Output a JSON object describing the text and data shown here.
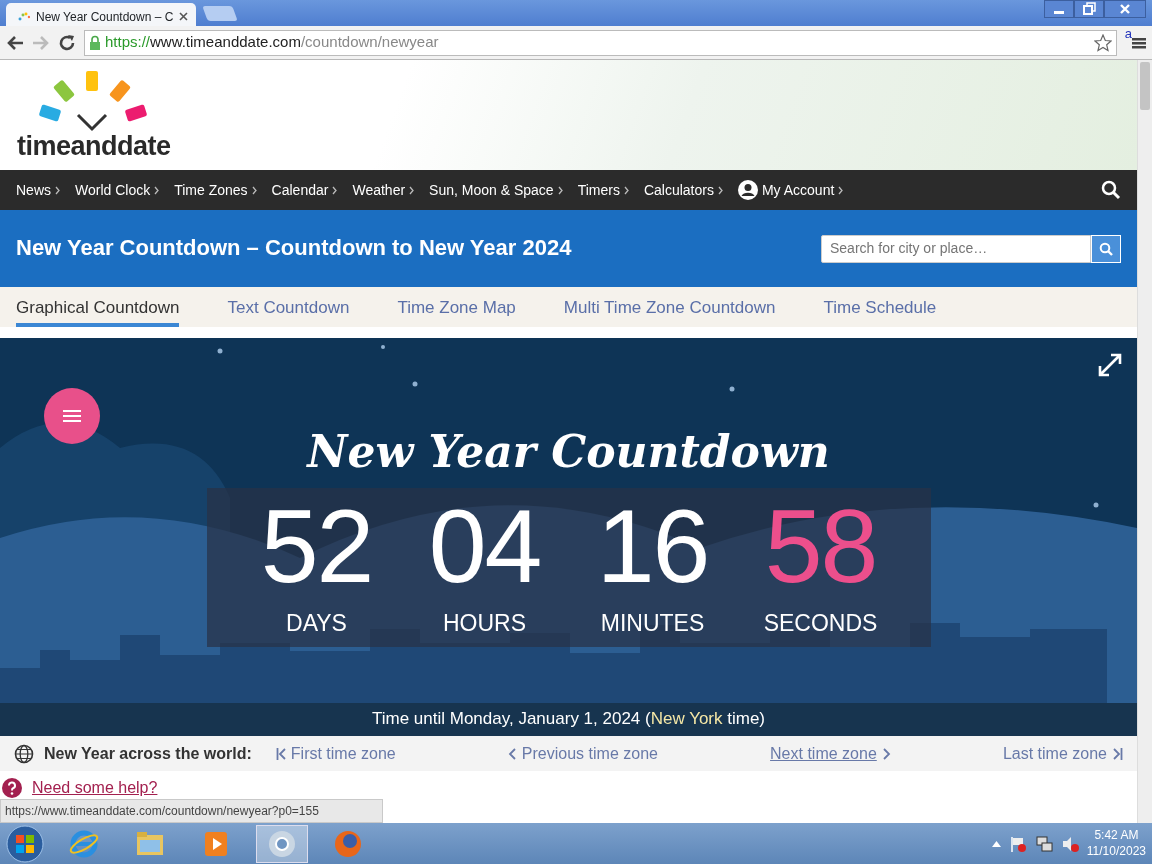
{
  "browser": {
    "tab_title": "New Year Countdown – C",
    "url": {
      "scheme": "https://",
      "host": "www.timeanddate.com",
      "path": "/countdown/newyear"
    },
    "extension_badge": "a"
  },
  "site": {
    "logo_text": "timeanddate",
    "nav": [
      {
        "label": "News"
      },
      {
        "label": "World Clock"
      },
      {
        "label": "Time Zones"
      },
      {
        "label": "Calendar"
      },
      {
        "label": "Weather"
      },
      {
        "label": "Sun, Moon & Space"
      },
      {
        "label": "Timers"
      },
      {
        "label": "Calculators"
      },
      {
        "label": "My Account",
        "kind": "account"
      }
    ],
    "page_title": "New Year Countdown – Countdown to New Year 2024",
    "search": {
      "placeholder": "Search for city or place…"
    },
    "subtabs": [
      {
        "label": "Graphical Countdown",
        "selected": true
      },
      {
        "label": "Text Countdown",
        "selected": false
      },
      {
        "label": "Time Zone Map",
        "selected": false
      },
      {
        "label": "Multi Time Zone Countdown",
        "selected": false
      },
      {
        "label": "Time Schedule",
        "selected": false
      }
    ],
    "countdown": {
      "title": "New Year Countdown",
      "units": [
        {
          "value": "52",
          "label": "DAYS",
          "highlight": false
        },
        {
          "value": "04",
          "label": "HOURS",
          "highlight": false
        },
        {
          "value": "16",
          "label": "MINUTES",
          "highlight": false
        },
        {
          "value": "58",
          "label": "SECONDS",
          "highlight": true
        }
      ],
      "caption": {
        "before": "Time until Monday, January 1, 2024 (",
        "place": "New York",
        "after": " time)"
      }
    },
    "world_nav": {
      "label": "New Year across the world:",
      "links": [
        {
          "label": "First time zone",
          "kind": "first",
          "hovered": false
        },
        {
          "label": "Previous time zone",
          "kind": "prev",
          "hovered": false
        },
        {
          "label": "Next time zone",
          "kind": "next",
          "hovered": true
        },
        {
          "label": "Last time zone",
          "kind": "last",
          "hovered": false
        }
      ]
    },
    "help": "Need some help?",
    "status_url": "https://www.timeanddate.com/countdown/newyear?p0=155"
  },
  "taskbar": {
    "time": "5:42 AM",
    "date": "11/10/2023"
  }
}
